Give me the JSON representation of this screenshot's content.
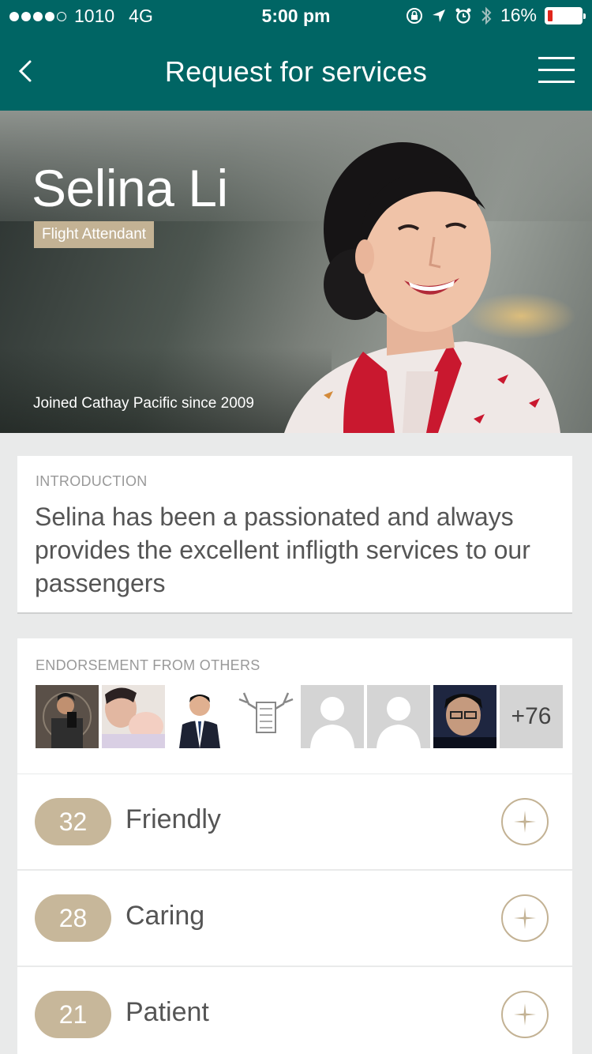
{
  "status": {
    "carrier": "1010",
    "network": "4G",
    "time": "5:00 pm",
    "battery": "16%",
    "battery_level": 0.16,
    "signal_bars": 4
  },
  "nav": {
    "title": "Request for services",
    "back_icon": "chevron-left-icon",
    "menu_icon": "hamburger-icon"
  },
  "profile": {
    "name": "Selina Li",
    "role": "Flight Attendant",
    "joined": "Joined Cathay Pacific since 2009"
  },
  "introduction": {
    "label": "INTRODUCTION",
    "text": "Selina has been a passionated and always provides the excellent infligth services to our passengers"
  },
  "endorsements": {
    "label": "ENDORSEMENT FROM OTHERS",
    "more": "+76",
    "traits": [
      {
        "count": "32",
        "label": "Friendly"
      },
      {
        "count": "28",
        "label": "Caring"
      },
      {
        "count": "21",
        "label": "Patient"
      }
    ]
  },
  "colors": {
    "brand": "#006564",
    "accent": "#c3b294",
    "battery_low": "#e0261b"
  }
}
